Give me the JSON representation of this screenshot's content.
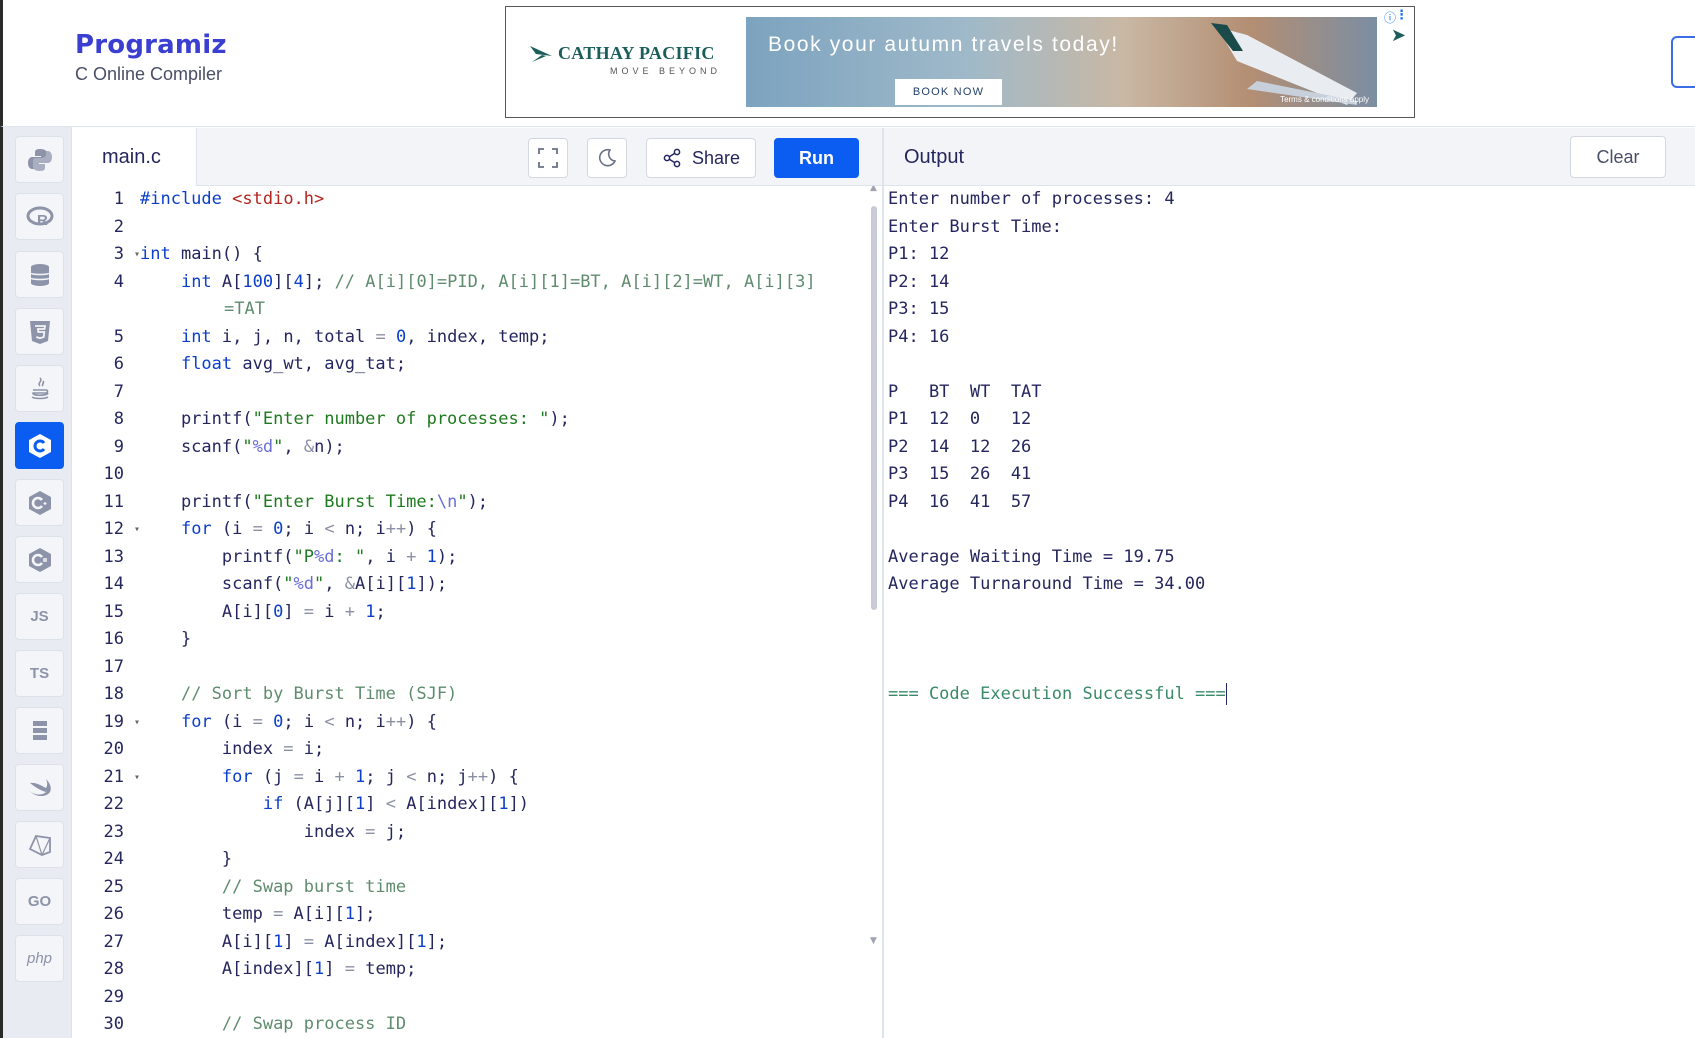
{
  "header": {
    "logo_text": "Programiz",
    "subtitle": "C Online Compiler"
  },
  "ad": {
    "brand": "CATHAY PACIFIC",
    "tagline": "MOVE BEYOND",
    "headline": "Book your autumn travels today!",
    "cta": "BOOK NOW",
    "terms": "Terms & conditions apply"
  },
  "sidebar": {
    "items": [
      {
        "name": "python",
        "icon": "python-icon",
        "label": ""
      },
      {
        "name": "r",
        "icon": "r-icon",
        "label": ""
      },
      {
        "name": "sql",
        "icon": "database-icon",
        "label": ""
      },
      {
        "name": "html",
        "icon": "html5-icon",
        "label": ""
      },
      {
        "name": "java",
        "icon": "java-icon",
        "label": ""
      },
      {
        "name": "c",
        "icon": "c-icon",
        "label": "",
        "active": true
      },
      {
        "name": "cpp",
        "icon": "cpp-icon",
        "label": ""
      },
      {
        "name": "csharp",
        "icon": "csharp-icon",
        "label": ""
      },
      {
        "name": "js",
        "icon": "js-icon",
        "label": "JS"
      },
      {
        "name": "ts",
        "icon": "ts-icon",
        "label": "TS"
      },
      {
        "name": "sql2",
        "icon": "stack-icon",
        "label": ""
      },
      {
        "name": "swift",
        "icon": "swift-icon",
        "label": ""
      },
      {
        "name": "ruby",
        "icon": "ruby-icon",
        "label": ""
      },
      {
        "name": "go",
        "icon": "go-icon",
        "label": "GO"
      },
      {
        "name": "php",
        "icon": "php-icon",
        "label": "php"
      }
    ]
  },
  "editor": {
    "filename": "main.c",
    "share_label": "Share",
    "run_label": "Run",
    "line_numbers": [
      "1",
      "2",
      "3",
      "4",
      "",
      "5",
      "6",
      "7",
      "8",
      "9",
      "10",
      "11",
      "12",
      "13",
      "14",
      "15",
      "16",
      "17",
      "18",
      "19",
      "20",
      "21",
      "22",
      "23",
      "24",
      "25",
      "26",
      "27",
      "28",
      "29",
      "30"
    ]
  },
  "output": {
    "title": "Output",
    "clear_label": "Clear",
    "lines": [
      "Enter number of processes: 4",
      "Enter Burst Time:",
      "P1: 12",
      "P2: 14",
      "P3: 15",
      "P4: 16",
      "",
      "P   BT  WT  TAT",
      "P1  12  0   12",
      "P2  14  12  26",
      "P3  15  26  41",
      "P4  16  41  57",
      "",
      "Average Waiting Time = 19.75",
      "Average Turnaround Time = 34.00",
      "",
      "",
      ""
    ],
    "status": "=== Code Execution Successful ==="
  },
  "colors": {
    "accent": "#0b5cf0",
    "keyword": "#0b3fcc",
    "string": "#1e7a1e",
    "comment": "#5f8c6e"
  }
}
